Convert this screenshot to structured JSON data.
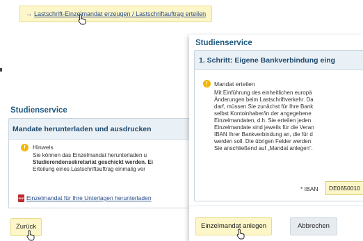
{
  "top_link": {
    "arrow": "→",
    "label": "Lastschrift-Einzelmandat erzeugen / Lastschriftauftrag erteilen"
  },
  "left": {
    "section_title": "Studienservice",
    "box_header": "Mandate herunterladen und ausdrucken",
    "hint_icon": "!",
    "hint_title": "Hinweis",
    "hint_lines": [
      "Sie können das Einzelmandat herunterladen u",
      "Studierendensekretariat geschickt werden. Ei",
      "Erteilung eines Lastschriftauftrag einmalig ver"
    ],
    "pdf_icon_text": "PDF",
    "pdf_link": "Einzelmandat für Ihre Unterlagen herunterladen",
    "back_button": "Zurück"
  },
  "right": {
    "section_title": "Studienservice",
    "box_header": "1. Schritt: Eigene Bankverbindung eing",
    "mandate_icon": "!",
    "mandate_title": "Mandat erteilen",
    "mandate_lines": [
      "Mit Einführung des einheitlichen europä",
      "Änderungen beim Lastschriftverkehr. Da",
      "darf, müssen Sie zunächst für Ihre Bank",
      "selbst Kontoinhaber/in der angegebene",
      "Einzelmandaten, d.h. Sie erteilen jeden",
      "Einzelmandate sind jeweils für die Veran",
      "IBAN Ihrer Bankverbindung an, die für d",
      "werden soll. Die übrigen Felder werden",
      "Sie anschließend auf „Mandat anlegen“."
    ],
    "iban_label": "* IBAN",
    "iban_value": "DE0650010",
    "create_button": "Einzelmandat anlegen",
    "cancel_button": "Abbrechen"
  },
  "colors": {
    "accent_title": "#1f5a82",
    "link": "#2a4d8a",
    "yellow_button": "#fdf6c8",
    "hint_icon": "#f2b705",
    "panel_header": "#eaf1f6"
  },
  "icons": {
    "cursor": "hand-pointer-icon",
    "hint": "warning-icon",
    "pdf": "pdf-icon"
  }
}
